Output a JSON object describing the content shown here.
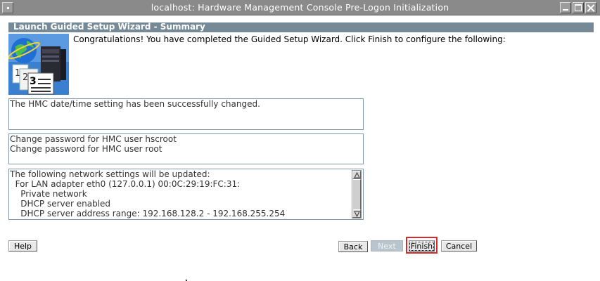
{
  "window": {
    "title": "localhost: Hardware Management Console Pre-Logon Initialization"
  },
  "header": {
    "title": "Launch Guided Setup Wizard - Summary"
  },
  "intro_text": "Congratulations! You have completed the Guided Setup Wizard. Click Finish to configure the following:",
  "summary_boxes": [
    {
      "lines": [
        "The HMC date/time setting has been successfully changed."
      ]
    },
    {
      "lines": [
        "Change password for HMC user hscroot",
        "Change password for HMC user root"
      ]
    },
    {
      "lines": [
        "The following network settings will be updated:",
        "  For LAN adapter eth0 (127.0.0.1) 00:0C:29:19:FC:31:",
        "    Private network",
        "    DHCP server enabled",
        "    DHCP server address range: 192.168.128.2 - 192.168.255.254"
      ]
    }
  ],
  "buttons": {
    "help": "Help",
    "back": "Back",
    "next": "Next",
    "finish": "Finish",
    "cancel": "Cancel"
  },
  "states": {
    "next_enabled": false,
    "finish_highlighted": true
  },
  "icons": {
    "window_menu": "window-menu-icon",
    "minimize": "minimize-icon",
    "maximize": "maximize-icon",
    "close": "close-icon",
    "wizard": "wizard-globe-server-icon",
    "scroll_up": "scroll-up-arrow-icon",
    "scroll_down": "scroll-down-arrow-icon",
    "cursor": "mouse-pointer-icon"
  },
  "colors": {
    "title_bar": "#8a8a8a",
    "header_strip": "#758a96",
    "box_border": "#7f98a6",
    "highlight": "#d42a2a"
  }
}
